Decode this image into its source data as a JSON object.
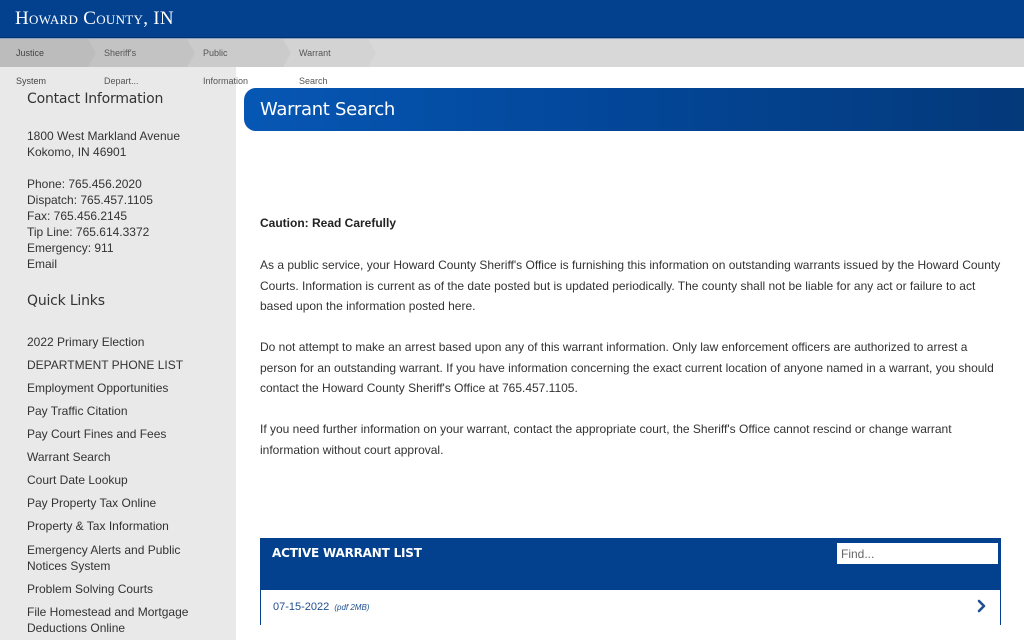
{
  "site": {
    "title": "Howard County, IN"
  },
  "breadcrumb": [
    {
      "label": "Justice System"
    },
    {
      "label": "Sheriff's Depart..."
    },
    {
      "label": "Public Information"
    },
    {
      "label": "Warrant Search"
    }
  ],
  "sidebar": {
    "contact_heading": "Contact Information",
    "address": [
      "1800 West Markland Avenue",
      "Kokomo, IN 46901"
    ],
    "contacts": [
      "Phone: 765.456.2020",
      "Dispatch: 765.457.1105",
      "Fax: 765.456.2145",
      "Tip Line: 765.614.3372",
      "Emergency: 911",
      "Email"
    ],
    "quicklinks_heading": "Quick Links",
    "quicklinks": [
      {
        "label": "2022 Primary Election"
      },
      {
        "label": "DEPARTMENT PHONE LIST"
      },
      {
        "label": "Employment Opportunities"
      },
      {
        "label": "Pay Traffic Citation"
      },
      {
        "label": "Pay Court Fines and Fees"
      },
      {
        "label": "Warrant Search"
      },
      {
        "label": "Court Date Lookup"
      },
      {
        "label": "Pay Property Tax Online"
      },
      {
        "label": "Property & Tax Information"
      },
      {
        "label": "Emergency Alerts and Public Notices System"
      },
      {
        "label": "Problem Solving Courts"
      },
      {
        "label": "File Homestead and Mortgage Deductions Online"
      }
    ]
  },
  "main": {
    "title": "Warrant Search",
    "caution": "Caution: Read Carefully",
    "paragraphs": [
      "As a public service, your Howard County Sheriff's Office is furnishing this information on outstanding warrants issued by the Howard County Courts. Information is current as of the date posted but is updated periodically. The county shall not be liable for any act or failure to act based upon the information posted here.",
      "Do not attempt to make an arrest based upon any of this warrant information. Only law enforcement officers are authorized to arrest a person for an outstanding warrant. If you have information concerning the exact current location of anyone named in a warrant, you should contact the Howard County Sheriff's Office at 765.457.1105.",
      "If you need further information on your warrant, contact the appropriate court, the Sheriff's Office cannot rescind or change warrant information without court approval."
    ],
    "warrant_list": {
      "title": "ACTIVE WARRANT LIST",
      "find_placeholder": "Find...",
      "items": [
        {
          "date": "07-15-2022",
          "meta": "(pdf 2MB)"
        }
      ]
    }
  },
  "colors": {
    "brand_blue": "#03418f",
    "sidebar_bg": "#e9e9e9",
    "link_blue": "#1e4f8f"
  }
}
